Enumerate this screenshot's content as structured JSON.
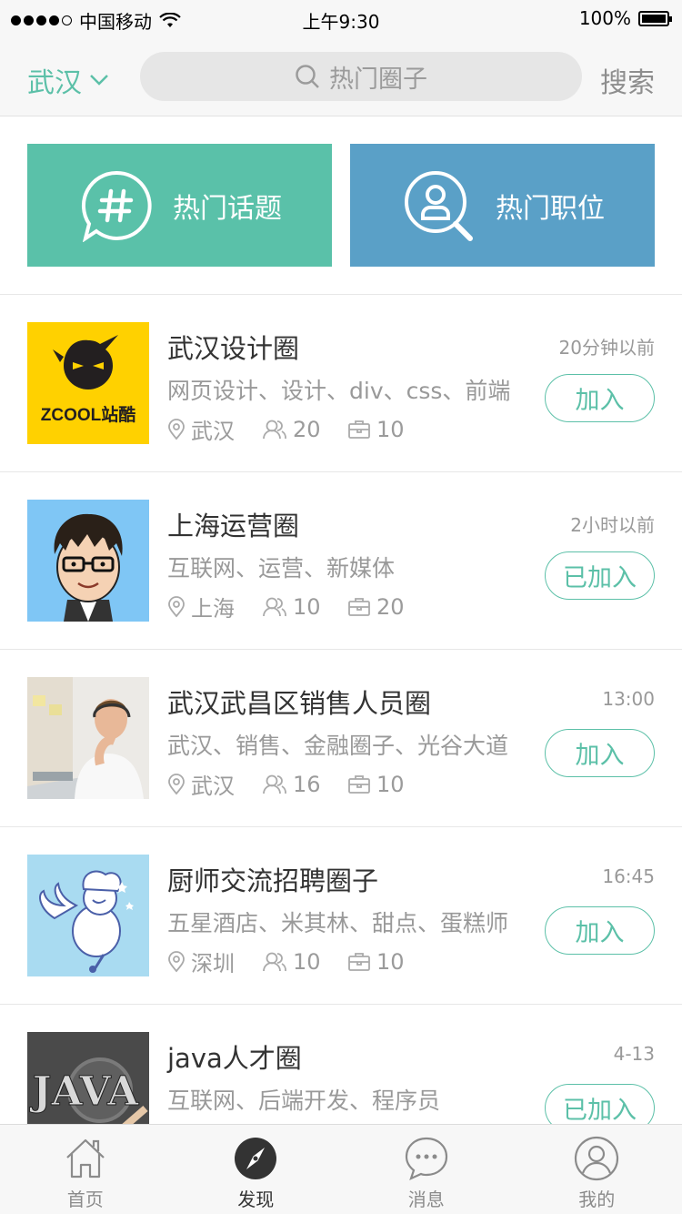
{
  "status_bar": {
    "carrier": "中国移动",
    "time": "上午9:30",
    "battery": "100%"
  },
  "header": {
    "city": "武汉",
    "search_placeholder": "热门圈子",
    "search_button": "搜索"
  },
  "banners": [
    {
      "label": "热门话题",
      "icon": "hashtag-chat-icon",
      "color": "#5ac1a9"
    },
    {
      "label": "热门职位",
      "icon": "person-search-icon",
      "color": "#5aa0c7"
    }
  ],
  "circles": [
    {
      "title": "武汉设计圈",
      "time": "20分钟以前",
      "tags": "网页设计、设计、div、css、前端",
      "location": "武汉",
      "members": "20",
      "jobs": "10",
      "button": "加入"
    },
    {
      "title": "上海运营圈",
      "time": "2小时以前",
      "tags": "互联网、运营、新媒体",
      "location": "上海",
      "members": "10",
      "jobs": "20",
      "button": "已加入"
    },
    {
      "title": "武汉武昌区销售人员圈",
      "time": "13:00",
      "tags": "武汉、销售、金融圈子、光谷大道",
      "location": "武汉",
      "members": "16",
      "jobs": "10",
      "button": "加入"
    },
    {
      "title": "厨师交流招聘圈子",
      "time": "16:45",
      "tags": "五星酒店、米其林、甜点、蛋糕师",
      "location": "深圳",
      "members": "10",
      "jobs": "10",
      "button": "加入"
    },
    {
      "title": "java人才圈",
      "time": "4-13",
      "tags": "互联网、后端开发、程序员",
      "location": "",
      "members": "",
      "jobs": "",
      "button": "已加入"
    }
  ],
  "tabbar": [
    {
      "label": "首页",
      "icon": "home-icon"
    },
    {
      "label": "发现",
      "icon": "compass-icon"
    },
    {
      "label": "消息",
      "icon": "chat-icon"
    },
    {
      "label": "我的",
      "icon": "profile-icon"
    }
  ],
  "colors": {
    "accent": "#5cc0a8",
    "topics_banner": "#5ac1a9",
    "jobs_banner": "#5aa0c7"
  }
}
